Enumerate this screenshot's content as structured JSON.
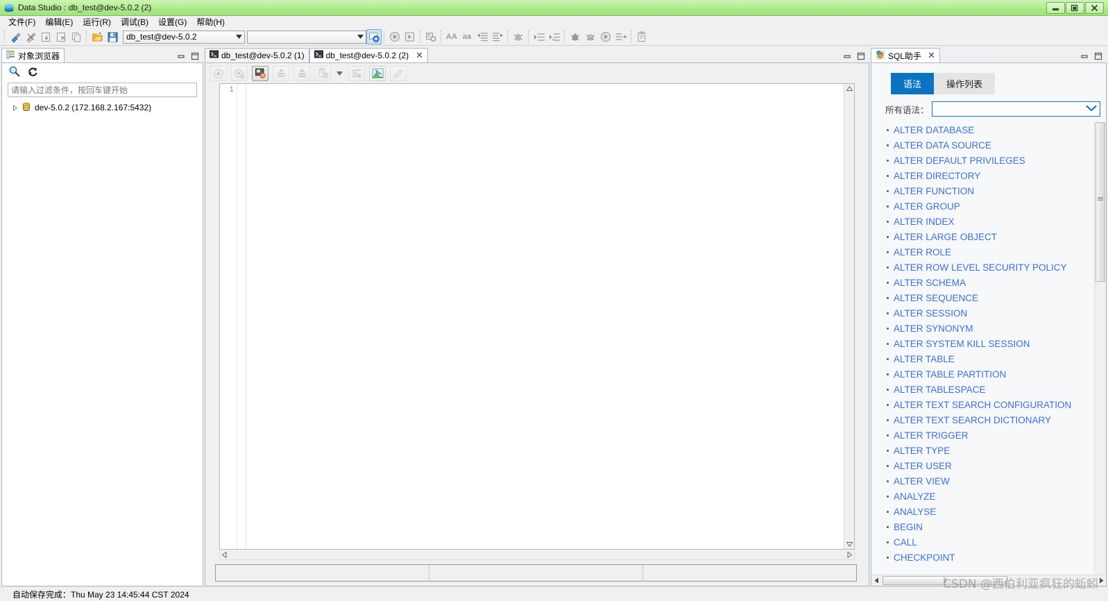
{
  "window": {
    "title": "Data Studio : db_test@dev-5.0.2 (2)",
    "icon": "app-stack-icon",
    "minimize_label": "—",
    "maximize_label": "❐",
    "close_label": "✕"
  },
  "menu": {
    "items": [
      {
        "label": "文件(F)"
      },
      {
        "label": "编辑(E)"
      },
      {
        "label": "运行(R)"
      },
      {
        "label": "调试(B)"
      },
      {
        "label": "设置(G)"
      },
      {
        "label": "帮助(H)"
      }
    ]
  },
  "toolbar": {
    "buttons": [
      {
        "name": "new-connection-icon",
        "title": "新建连接"
      },
      {
        "name": "disconnect-icon",
        "title": "断开连接"
      },
      {
        "name": "import-icon",
        "title": "导入"
      },
      {
        "name": "export-icon",
        "title": "导出"
      },
      {
        "name": "copy-object-icon",
        "title": "复制"
      },
      {
        "name": "open-folder-icon",
        "title": "打开"
      },
      {
        "name": "save-icon",
        "title": "保存"
      },
      {
        "name": "new-sql-terminal-icon",
        "title": "新建SQL终端"
      },
      {
        "name": "execute-icon",
        "title": "执行"
      },
      {
        "name": "execute-plan-icon",
        "title": "执行计划"
      },
      {
        "name": "settings-object-icon",
        "title": "对象设置"
      },
      {
        "name": "uppercase-icon",
        "title": "AA"
      },
      {
        "name": "lowercase-icon",
        "title": "aa"
      },
      {
        "name": "indent-left-icon",
        "title": "减少缩进"
      },
      {
        "name": "indent-right-icon",
        "title": "增加缩进"
      },
      {
        "name": "debug-icon",
        "title": "调试"
      },
      {
        "name": "step-over-icon",
        "title": "单步跳过"
      },
      {
        "name": "step-into-icon",
        "title": "单步进入"
      },
      {
        "name": "breakpoint-icon",
        "title": "断点"
      },
      {
        "name": "bug-icon",
        "title": "调试器"
      },
      {
        "name": "resume-icon",
        "title": "继续"
      },
      {
        "name": "terminate-icon",
        "title": "终止"
      },
      {
        "name": "clipboard-icon",
        "title": "剪贴板"
      }
    ],
    "connection_combo_value": "db_test@dev-5.0.2",
    "schema_combo_value": ""
  },
  "object_browser": {
    "tab_label": "对象浏览器",
    "tab_icon": "object-browser-icon",
    "search_icon": "magnifier-icon",
    "refresh_icon": "refresh-icon",
    "filter_placeholder": "请输入过滤条件，按回车键开始",
    "filter_value": "",
    "tree": [
      {
        "label": "dev-5.0.2 (172.168.2.167:5432)",
        "icon": "database-icon",
        "expanded": false
      }
    ],
    "minimize_icon": "minimize-icon",
    "maximize_icon": "maximize-icon"
  },
  "editor": {
    "tabs": [
      {
        "label": "db_test@dev-5.0.2 (1)",
        "icon": "terminal-icon",
        "active": false,
        "closable": false
      },
      {
        "label": "db_test@dev-5.0.2 (2)",
        "icon": "terminal-icon",
        "active": true,
        "closable": true
      }
    ],
    "close_label": "✕",
    "minimize_icon": "minimize-icon",
    "maximize_icon": "maximize-icon",
    "toolbar_buttons": [
      {
        "name": "execute-query-icon",
        "title": "执行",
        "state": "disabled"
      },
      {
        "name": "execute-plan-icon",
        "title": "执行计划",
        "state": "disabled"
      },
      {
        "name": "execute-history-icon",
        "title": "历史执行",
        "state": "active"
      },
      {
        "name": "commit-icon",
        "title": "提交",
        "state": "disabled"
      },
      {
        "name": "rollback-icon",
        "title": "回滚",
        "state": "disabled"
      },
      {
        "name": "query-history-icon",
        "title": "查询历史",
        "state": "disabled"
      },
      {
        "name": "format-icon",
        "title": "格式化",
        "state": "disabled"
      },
      {
        "name": "visual-explain-icon",
        "title": "可视化解释",
        "state": "enabled"
      },
      {
        "name": "edit-icon",
        "title": "编辑",
        "state": "disabled"
      }
    ],
    "line_numbers": [
      "1"
    ],
    "content": "",
    "status_cells": [
      "",
      "",
      ""
    ]
  },
  "sql_assistant": {
    "tab_label": "SQL助手",
    "tab_icon": "sql-assistant-icon",
    "close_label": "✕",
    "minimize_icon": "minimize-icon",
    "maximize_icon": "maximize-icon",
    "tabs": [
      {
        "label": "语法",
        "active": true
      },
      {
        "label": "操作列表",
        "active": false
      }
    ],
    "filter_label": "所有语法：",
    "filter_value": "",
    "syntax_items": [
      "ALTER DATABASE",
      "ALTER DATA SOURCE",
      "ALTER DEFAULT PRIVILEGES",
      "ALTER DIRECTORY",
      "ALTER FUNCTION",
      "ALTER GROUP",
      "ALTER INDEX",
      "ALTER LARGE OBJECT",
      "ALTER ROLE",
      "ALTER ROW LEVEL SECURITY POLICY",
      "ALTER SCHEMA",
      "ALTER SEQUENCE",
      "ALTER SESSION",
      "ALTER SYNONYM",
      "ALTER SYSTEM KILL SESSION",
      "ALTER TABLE",
      "ALTER TABLE PARTITION",
      "ALTER TABLESPACE",
      "ALTER TEXT SEARCH CONFIGURATION",
      "ALTER TEXT SEARCH DICTIONARY",
      "ALTER TRIGGER",
      "ALTER TYPE",
      "ALTER USER",
      "ALTER VIEW",
      "ANALYZE",
      "ANALYSE",
      "BEGIN",
      "CALL",
      "CHECKPOINT"
    ]
  },
  "statusbar": {
    "message": "自动保存完成：Thu May 23 14:45:44 CST 2024"
  },
  "watermark": {
    "text": "CSDN @西伯利亚疯狂的蚯蚓"
  },
  "colors": {
    "title_green": "#a8e884",
    "accent_blue": "#0a73c4",
    "link_blue": "#3b6fd4",
    "panel_bg": "#f0f0f0"
  }
}
